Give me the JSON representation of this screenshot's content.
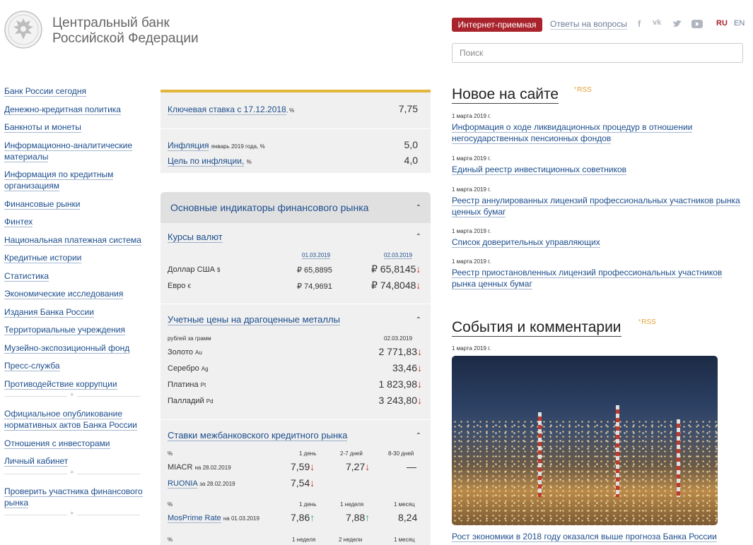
{
  "header": {
    "bank_name_line1": "Центральный банк",
    "bank_name_line2": "Российской Федерации",
    "reception_button": "Интернет-приемная",
    "faq_link": "Ответы на вопросы",
    "social_icons": [
      "facebook-icon",
      "vk-icon",
      "twitter-icon",
      "youtube-icon"
    ],
    "lang_ru": "RU",
    "lang_en": "EN",
    "search_placeholder": "Поиск",
    "accent_color": "#a8232b"
  },
  "left_menu": {
    "group1": [
      "Банк России сегодня",
      "Денежно-кредитная политика",
      "Банкноты и монеты",
      "Информационно-аналитические материалы",
      "Информация по кредитным организациям",
      "Финансовые рынки",
      "Финтех",
      "Национальная платежная система",
      "Кредитные истории",
      "Статистика",
      "Экономические исследования",
      "Издания Банка России",
      "Территориальные учреждения",
      "Музейно-экспозиционный фонд",
      "Пресс-служба",
      "Противодействие коррупции"
    ],
    "group2": [
      "Официальное опубликование нормативных актов Банка России",
      "Отношения с инвесторами",
      "Личный кабинет"
    ],
    "group3": [
      "Проверить участника финансового рынка"
    ]
  },
  "key_rates": {
    "key_rate_label": "Ключевая ставка с 17.12.2018",
    "key_rate_unit": ", %",
    "key_rate_value": "7,75",
    "inflation_label": "Инфляция",
    "inflation_period": "январь 2019 года, %",
    "inflation_value": "5,0",
    "target_label": "Цель по инфляции,",
    "target_unit": "%",
    "target_value": "4,0"
  },
  "indicators": {
    "title": "Основные индикаторы финансового рынка",
    "currency": {
      "title": "Курсы валют",
      "date1": "01.03.2019",
      "date2": "02.03.2019",
      "rows": [
        {
          "name": "Доллар США",
          "sym": "$",
          "v1": "₽ 65,8895",
          "v2": "₽ 65,8145"
        },
        {
          "name": "Евро",
          "sym": "€",
          "v1": "₽ 74,9691",
          "v2": "₽ 74,8048"
        }
      ]
    },
    "metals": {
      "title": "Учетные цены на драгоценные металлы",
      "unit": "рублей за грамм",
      "date": "02.03.2019",
      "rows": [
        {
          "name": "Золото",
          "sym": "Au",
          "value": "2 771,83"
        },
        {
          "name": "Серебро",
          "sym": "Ag",
          "value": "33,46"
        },
        {
          "name": "Платина",
          "sym": "Pt",
          "value": "1 823,98"
        },
        {
          "name": "Палладий",
          "sym": "Pd",
          "value": "3 243,80"
        }
      ]
    },
    "interbank": {
      "title": "Ставки межбанковского кредитного рынка",
      "pct": "%",
      "h1": [
        "1 день",
        "2-7 дней",
        "8-30 дней"
      ],
      "miacr": {
        "name": "MIACR",
        "date": "на 28.02.2019",
        "v1": "7,59",
        "v2": "7,27",
        "v3": "—"
      },
      "ruonia": {
        "name": "RUONIA",
        "date": "за 28.02.2019",
        "v1": "7,54"
      },
      "h2": [
        "1 день",
        "1 неделя",
        "1 месяц"
      ],
      "mosprime": {
        "name": "MosPrime Rate",
        "date": "на 01.03.2019",
        "v1": "7,86",
        "v2": "7,88",
        "v3": "8,24"
      },
      "h3": [
        "1 неделя",
        "2 недели",
        "1 месяц"
      ]
    }
  },
  "news": {
    "title": "Новое на сайте",
    "rss": "RSS",
    "items": [
      {
        "date": "1 марта 2019 г.",
        "text": "Информация о ходе ликвидационных процедур в отношении негосударственных пенсионных фондов"
      },
      {
        "date": "1 марта 2019 г.",
        "text": "Единый реестр инвестиционных советников"
      },
      {
        "date": "1 марта 2019 г.",
        "text": "Реестр аннулированных лицензий профессиональных участников рынка ценных бумаг"
      },
      {
        "date": "1 марта 2019 г.",
        "text": "Список доверительных управляющих"
      },
      {
        "date": "1 марта 2019 г.",
        "text": "Реестр приостановленных лицензий профессиональных участников рынка ценных бумаг"
      }
    ]
  },
  "events": {
    "title": "События и комментарии",
    "rss": "RSS",
    "date": "1 марта 2019 г.",
    "caption": "Рост экономики в 2018 году оказался выше прогноза Банка России"
  },
  "arrows": {
    "down": "↓",
    "up": "↑",
    "chevron": "⌃"
  }
}
